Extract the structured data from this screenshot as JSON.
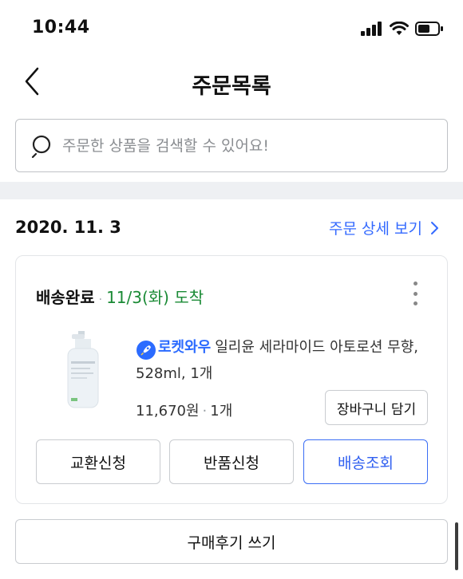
{
  "status_bar": {
    "time": "10:44"
  },
  "header": {
    "title": "주문목록"
  },
  "search": {
    "placeholder": "주문한 상품을 검색할 수 있어요!"
  },
  "order": {
    "date": "2020. 11. 3",
    "detail_link": "주문 상세 보기",
    "status_label": "배송완료",
    "arrival_text": "11/3(화) 도착",
    "rocket_label": "로켓와우",
    "product_name": "일리윤 세라마이드 아토로션 무향, 528ml, 1개",
    "price": "11,670원",
    "quantity": "1개",
    "cart_button": "장바구니 담기",
    "actions": {
      "exchange": "교환신청",
      "return": "반품신청",
      "tracking": "배송조회"
    },
    "review_button": "구매후기 쓰기"
  },
  "colors": {
    "accent_blue": "#346aff",
    "arrival_green": "#1a8a35",
    "border_gray": "#c9ccd0"
  },
  "icons": [
    "chevron-left-icon",
    "search-icon",
    "chevron-right-icon",
    "more-vertical-icon",
    "rocket-icon",
    "signal-icon",
    "wifi-icon",
    "battery-icon"
  ]
}
